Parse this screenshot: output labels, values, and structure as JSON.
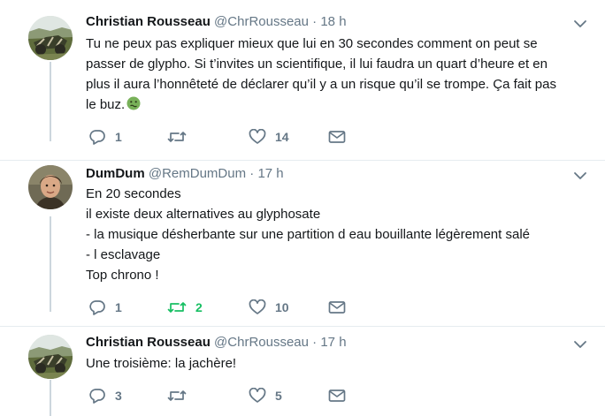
{
  "tweets": [
    {
      "name": "Christian Rousseau",
      "handle": "@ChrRousseau",
      "time": "18 h",
      "lines": [
        "Tu ne peux pas expliquer mieux que lui en 30 secondes comment on peut se",
        "passer de glypho. Si t’invites un scientifique, il lui faudra un quart d’heure et en",
        "plus il aura l’honnêteté de déclarer qu’il y a un risque qu’il se trompe. Ça fait pas",
        "le buz."
      ],
      "emoji": "nauseated-face-icon",
      "replies": "1",
      "retweets": "",
      "likes": "14"
    },
    {
      "name": "DumDum",
      "handle": "@RemDumDum",
      "time": "17 h",
      "lines": [
        "En 20 secondes",
        "il existe deux alternatives au glyphosate",
        "- la musique désherbante sur une partition d eau bouillante légèrement salé",
        "- l esclavage",
        "Top chrono !"
      ],
      "replies": "1",
      "retweets": "2",
      "retweeted": true,
      "likes": "10"
    },
    {
      "name": "Christian Rousseau",
      "handle": "@ChrRousseau",
      "time": "17 h",
      "lines": [
        "Une troisième: la jachère!"
      ],
      "replies": "3",
      "retweets": "",
      "likes": "5"
    }
  ],
  "separator": "·",
  "colors": {
    "text": "#14171a",
    "secondary": "#657786",
    "retweet_active": "#17bf63",
    "divider": "#e6ecf0",
    "thread_line": "#ccd6dd"
  },
  "icons": [
    "reply-icon",
    "retweet-icon",
    "like-icon",
    "message-icon",
    "chevron-down-icon"
  ]
}
